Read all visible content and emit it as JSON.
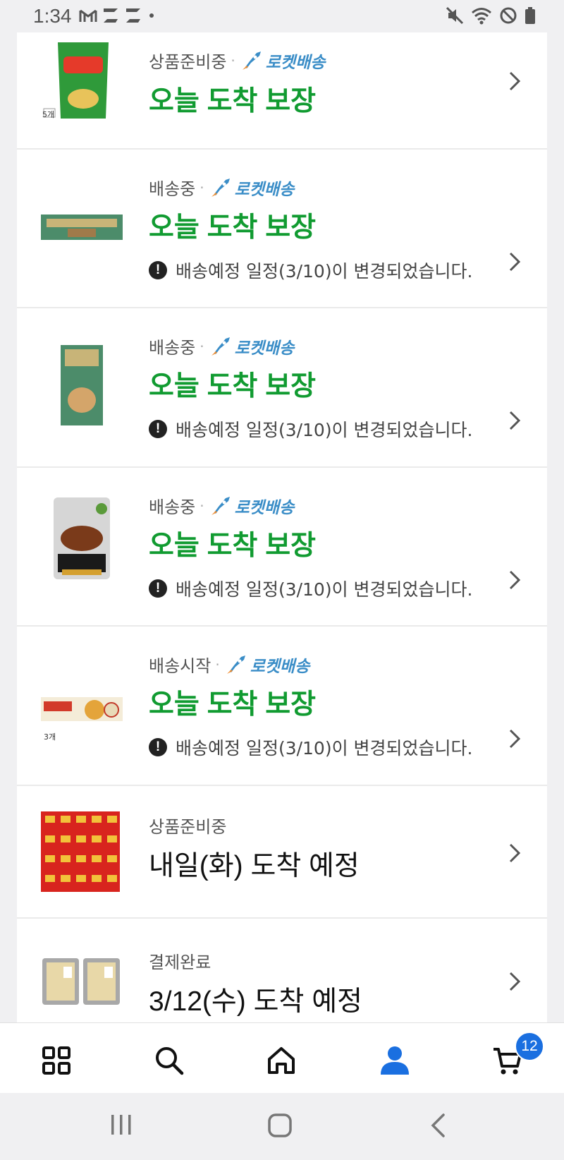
{
  "status_bar": {
    "time": "1:34"
  },
  "colors": {
    "arrival_green": "#119b31",
    "rocket_blue": "#3a8dc7",
    "accent_blue": "#1a6fe0"
  },
  "orders": [
    {
      "status": "상품준비중",
      "rocket_label": "로켓배송",
      "arrival": "오늘 도착 보장",
      "notice": "",
      "thumb": "chips-bag"
    },
    {
      "status": "배송중",
      "rocket_label": "로켓배송",
      "arrival": "오늘 도착 보장",
      "notice": "배송예정 일정(3/10)이 변경되었습니다.",
      "thumb": "cracker-box-flat"
    },
    {
      "status": "배송중",
      "rocket_label": "로켓배송",
      "arrival": "오늘 도착 보장",
      "notice": "배송예정 일정(3/10)이 변경되었습니다.",
      "thumb": "cracker-box-tall"
    },
    {
      "status": "배송중",
      "rocket_label": "로켓배송",
      "arrival": "오늘 도착 보장",
      "notice": "배송예정 일정(3/10)이 변경되었습니다.",
      "thumb": "noodle-pack"
    },
    {
      "status": "배송시작",
      "rocket_label": "로켓배송",
      "arrival": "오늘 도착 보장",
      "notice": "배송예정 일정(3/10)이 변경되었습니다.",
      "thumb": "wafer-box"
    },
    {
      "status": "상품준비중",
      "rocket_label": "",
      "arrival": "내일(화) 도착 예정",
      "notice": "",
      "thumb": "red-snack-cases"
    },
    {
      "status": "결제완료",
      "rocket_label": "",
      "arrival": "3/12(수) 도착 예정",
      "notice": "",
      "thumb": "food-trays"
    }
  ],
  "thumb_badges": {
    "chips": "5개",
    "wafer": "3개"
  },
  "bottom_nav": {
    "items": [
      "categories-icon",
      "search-icon",
      "home-icon",
      "my-account-icon",
      "cart-icon"
    ],
    "cart_count": "12"
  }
}
